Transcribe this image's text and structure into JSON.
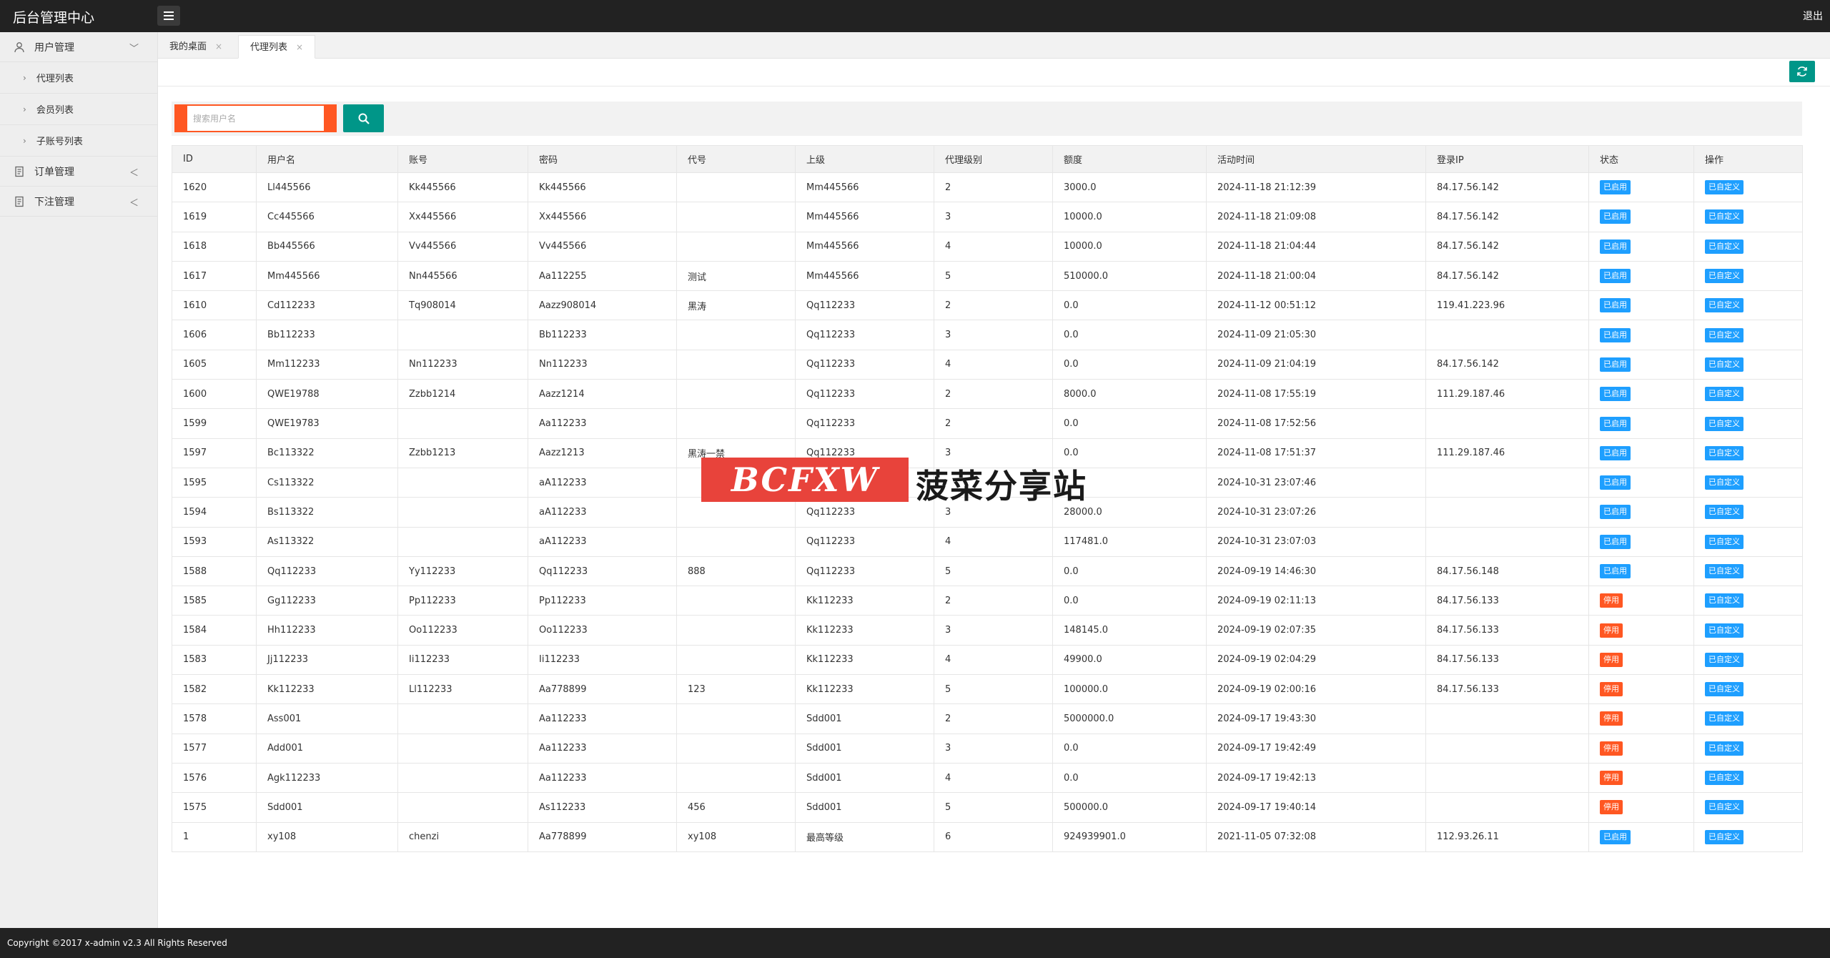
{
  "header": {
    "title": "后台管理中心",
    "logout": "退出"
  },
  "sidebar": {
    "groups": [
      {
        "label": "用户管理",
        "arrow": "﹀",
        "children": [
          "代理列表",
          "会员列表",
          "子账号列表"
        ]
      },
      {
        "label": "订单管理",
        "arrow": "＜",
        "children": []
      },
      {
        "label": "下注管理",
        "arrow": "＜",
        "children": []
      }
    ]
  },
  "tabs": [
    {
      "label": "我的桌面",
      "active": false
    },
    {
      "label": "代理列表",
      "active": true
    }
  ],
  "search": {
    "placeholder": "搜索用户名",
    "value": ""
  },
  "table": {
    "columns": [
      "ID",
      "用户名",
      "账号",
      "密码",
      "代号",
      "上级",
      "代理级别",
      "额度",
      "活动时间",
      "登录IP",
      "状态",
      "操作"
    ],
    "rows": [
      [
        "1620",
        "Ll445566",
        "Kk445566",
        "Kk445566",
        "",
        "Mm445566",
        "2",
        "3000.0",
        "2024-11-18 21:12:39",
        "84.17.56.142",
        "已启用",
        "已自定义"
      ],
      [
        "1619",
        "Cc445566",
        "Xx445566",
        "Xx445566",
        "",
        "Mm445566",
        "3",
        "10000.0",
        "2024-11-18 21:09:08",
        "84.17.56.142",
        "已启用",
        "已自定义"
      ],
      [
        "1618",
        "Bb445566",
        "Vv445566",
        "Vv445566",
        "",
        "Mm445566",
        "4",
        "10000.0",
        "2024-11-18 21:04:44",
        "84.17.56.142",
        "已启用",
        "已自定义"
      ],
      [
        "1617",
        "Mm445566",
        "Nn445566",
        "Aa112255",
        "测试",
        "Mm445566",
        "5",
        "510000.0",
        "2024-11-18 21:00:04",
        "84.17.56.142",
        "已启用",
        "已自定义"
      ],
      [
        "1610",
        "Cd112233",
        "Tq908014",
        "Aazz908014",
        "黑涛",
        "Qq112233",
        "2",
        "0.0",
        "2024-11-12 00:51:12",
        "119.41.223.96",
        "已启用",
        "已自定义"
      ],
      [
        "1606",
        "Bb112233",
        "",
        "Bb112233",
        "",
        "Qq112233",
        "3",
        "0.0",
        "2024-11-09 21:05:30",
        "",
        "已启用",
        "已自定义"
      ],
      [
        "1605",
        "Mm112233",
        "Nn112233",
        "Nn112233",
        "",
        "Qq112233",
        "4",
        "0.0",
        "2024-11-09 21:04:19",
        "84.17.56.142",
        "已启用",
        "已自定义"
      ],
      [
        "1600",
        "QWE19788",
        "Zzbb1214",
        "Aazz1214",
        "",
        "Qq112233",
        "2",
        "8000.0",
        "2024-11-08 17:55:19",
        "111.29.187.46",
        "已启用",
        "已自定义"
      ],
      [
        "1599",
        "QWE19783",
        "",
        "Aa112233",
        "",
        "Qq112233",
        "2",
        "0.0",
        "2024-11-08 17:52:56",
        "",
        "已启用",
        "已自定义"
      ],
      [
        "1597",
        "Bc113322",
        "Zzbb1213",
        "Aazz1213",
        "黑涛一禁",
        "Qq112233",
        "3",
        "0.0",
        "2024-11-08 17:51:37",
        "111.29.187.46",
        "已启用",
        "已自定义"
      ],
      [
        "1595",
        "Cs113322",
        "",
        "aA112233",
        "",
        "Qq112233",
        "",
        "",
        "2024-10-31 23:07:46",
        "",
        "已启用",
        "已自定义"
      ],
      [
        "1594",
        "Bs113322",
        "",
        "aA112233",
        "",
        "Qq112233",
        "3",
        "28000.0",
        "2024-10-31 23:07:26",
        "",
        "已启用",
        "已自定义"
      ],
      [
        "1593",
        "As113322",
        "",
        "aA112233",
        "",
        "Qq112233",
        "4",
        "117481.0",
        "2024-10-31 23:07:03",
        "",
        "已启用",
        "已自定义"
      ],
      [
        "1588",
        "Qq112233",
        "Yy112233",
        "Qq112233",
        "888",
        "Qq112233",
        "5",
        "0.0",
        "2024-09-19 14:46:30",
        "84.17.56.148",
        "已启用",
        "已自定义"
      ],
      [
        "1585",
        "Gg112233",
        "Pp112233",
        "Pp112233",
        "",
        "Kk112233",
        "2",
        "0.0",
        "2024-09-19 02:11:13",
        "84.17.56.133",
        "停用",
        "已自定义"
      ],
      [
        "1584",
        "Hh112233",
        "Oo112233",
        "Oo112233",
        "",
        "Kk112233",
        "3",
        "148145.0",
        "2024-09-19 02:07:35",
        "84.17.56.133",
        "停用",
        "已自定义"
      ],
      [
        "1583",
        "Jj112233",
        "Ii112233",
        "Ii112233",
        "",
        "Kk112233",
        "4",
        "49900.0",
        "2024-09-19 02:04:29",
        "84.17.56.133",
        "停用",
        "已自定义"
      ],
      [
        "1582",
        "Kk112233",
        "Ll112233",
        "Aa778899",
        "123",
        "Kk112233",
        "5",
        "100000.0",
        "2024-09-19 02:00:16",
        "84.17.56.133",
        "停用",
        "已自定义"
      ],
      [
        "1578",
        "Ass001",
        "",
        "Aa112233",
        "",
        "Sdd001",
        "2",
        "5000000.0",
        "2024-09-17 19:43:30",
        "",
        "停用",
        "已自定义"
      ],
      [
        "1577",
        "Add001",
        "",
        "Aa112233",
        "",
        "Sdd001",
        "3",
        "0.0",
        "2024-09-17 19:42:49",
        "",
        "停用",
        "已自定义"
      ],
      [
        "1576",
        "Agk112233",
        "",
        "Aa112233",
        "",
        "Sdd001",
        "4",
        "0.0",
        "2024-09-17 19:42:13",
        "",
        "停用",
        "已自定义"
      ],
      [
        "1575",
        "Sdd001",
        "",
        "As112233",
        "456",
        "Sdd001",
        "5",
        "500000.0",
        "2024-09-17 19:40:14",
        "",
        "停用",
        "已自定义"
      ],
      [
        "1",
        "xy108",
        "chenzi",
        "Aa778899",
        "xy108",
        "最高等级",
        "6",
        "924939901.0",
        "2021-11-05 07:32:08",
        "112.93.26.11",
        "已启用",
        "已自定义"
      ]
    ]
  },
  "watermark": {
    "text_en": "BCFXW",
    "text_cn": "菠菜分享站"
  },
  "footer": {
    "copyright": "Copyright ©2017 x-admin v2.3 All Rights Reserved"
  },
  "colors": {
    "topbar": "#222222",
    "primary": "#009688",
    "danger": "#ff5722",
    "info": "#1e9fff",
    "watermark": "#e8433b"
  }
}
